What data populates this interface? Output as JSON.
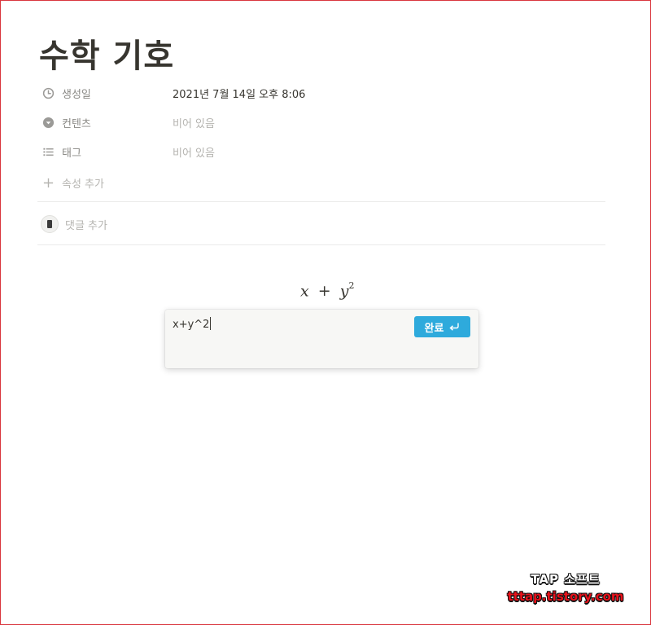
{
  "page": {
    "title": "수학 기호"
  },
  "properties": [
    {
      "icon": "clock-icon",
      "label": "생성일",
      "value": "2021년 7월 14일 오후 8:06",
      "empty": false
    },
    {
      "icon": "select-icon",
      "label": "컨텐츠",
      "value": "비어 있음",
      "empty": true
    },
    {
      "icon": "list-icon",
      "label": "태그",
      "value": "비어 있음",
      "empty": true
    }
  ],
  "add_property": {
    "icon": "plus-icon",
    "label": "속성 추가"
  },
  "comment": {
    "placeholder": "댓글 추가"
  },
  "equation": {
    "rendered_base": "x",
    "rendered_operator": "+",
    "rendered_var": "y",
    "rendered_exponent": "2"
  },
  "equation_editor": {
    "value": "x+y^2",
    "done_label": "완료",
    "done_icon": "enter-icon"
  },
  "watermark": {
    "line1": "TAP 소프트",
    "line2": "tttap.tistory.com"
  },
  "colors": {
    "accent": "#2eaadc",
    "text": "#37352f",
    "muted": "#8a8985",
    "placeholder": "#b5b4b0",
    "frame": "#d9363e"
  }
}
